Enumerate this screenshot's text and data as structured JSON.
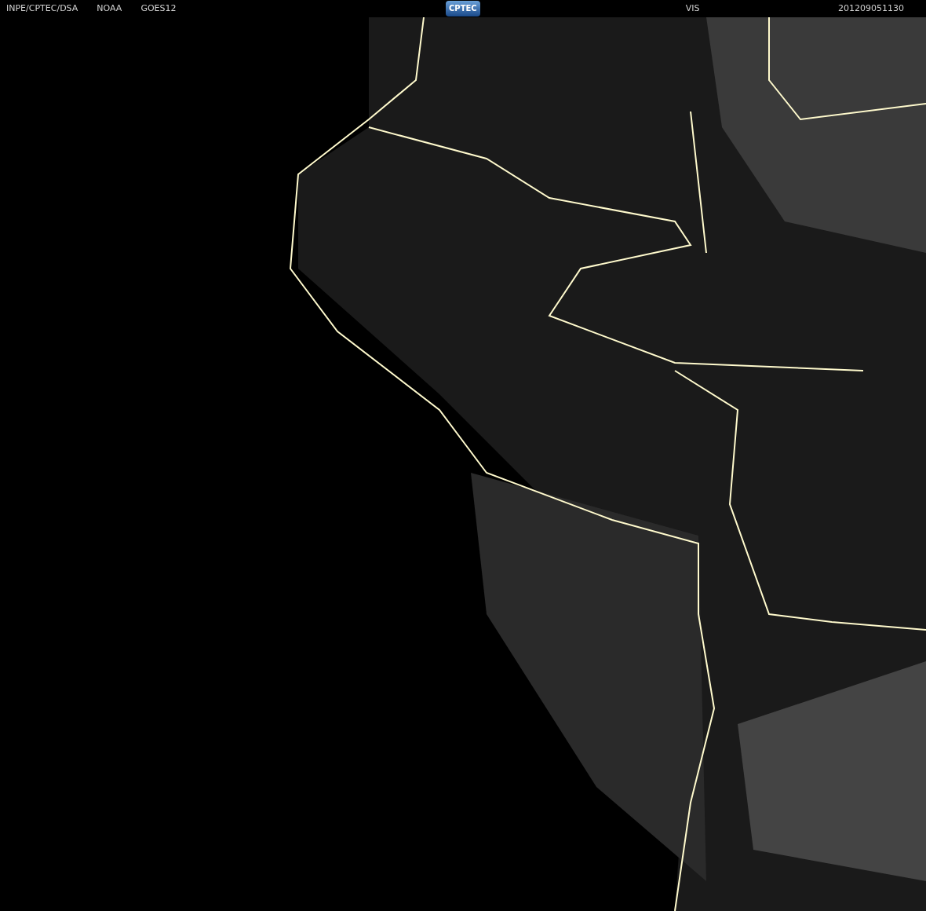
{
  "header": {
    "left": [
      "INPE/CPTEC/DSA",
      "NOAA",
      "GOES12"
    ],
    "logo": "CPTEC",
    "channel": "VIS",
    "timestamp": "201209051130"
  }
}
